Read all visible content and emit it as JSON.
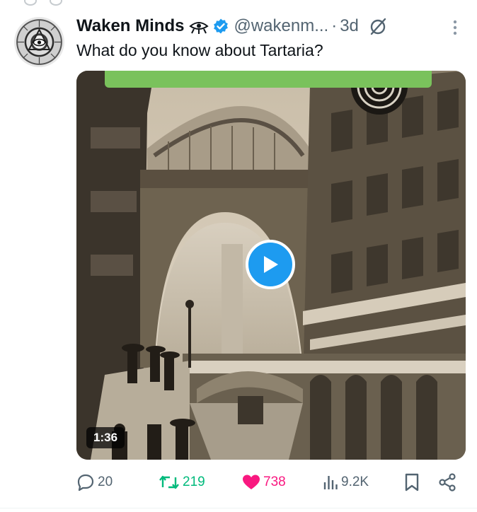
{
  "tweet": {
    "display_name": "Waken Minds",
    "handle": "@wakenm...",
    "separator": "·",
    "time": "3d",
    "text": "What do you know about Tartaria?"
  },
  "media": {
    "duration": "1:36"
  },
  "actions": {
    "replies": "20",
    "reposts": "219",
    "likes": "738",
    "views": "9.2K"
  },
  "colors": {
    "verified": "#1d9bf0",
    "repost": "#00ba7c",
    "like": "#f91880",
    "secondary_text": "#536471",
    "play_button": "#1d9bf0"
  },
  "icons": {
    "reply": "speech-bubble-icon",
    "repost": "repost-arrows-icon",
    "like": "heart-filled-icon",
    "views": "bar-chart-icon",
    "bookmark": "bookmark-icon",
    "share": "share-icon",
    "more": "vertical-ellipsis-icon",
    "grok": "slashed-circle-icon",
    "badge": "eye-pyramid-icon"
  }
}
